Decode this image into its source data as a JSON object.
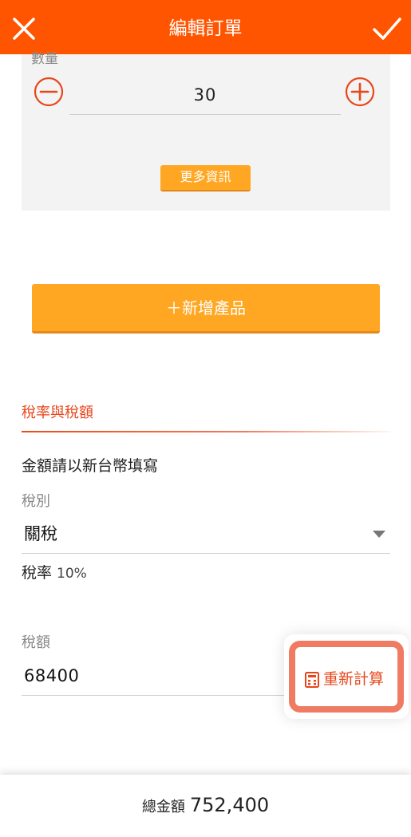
{
  "header": {
    "title": "編輯訂單"
  },
  "product": {
    "quantity_label": "數量",
    "quantity_value": "30",
    "more_info_label": "更多資訊"
  },
  "add_product_label": "＋新增產品",
  "tax": {
    "section_title": "稅率與稅額",
    "currency_note": "金額請以新台幣填寫",
    "type_label": "稅別",
    "type_value": "關稅",
    "rate_label": "稅率",
    "rate_value": "10%",
    "amount_label": "稅額",
    "amount_value": "68400",
    "recalculate_label": "重新計算"
  },
  "footer": {
    "total_label": "總金額",
    "total_value": "752,400"
  },
  "colors": {
    "header": "#ff5500",
    "accent": "#e8461a",
    "button": "#ffa722",
    "highlight": "#f07b63"
  }
}
